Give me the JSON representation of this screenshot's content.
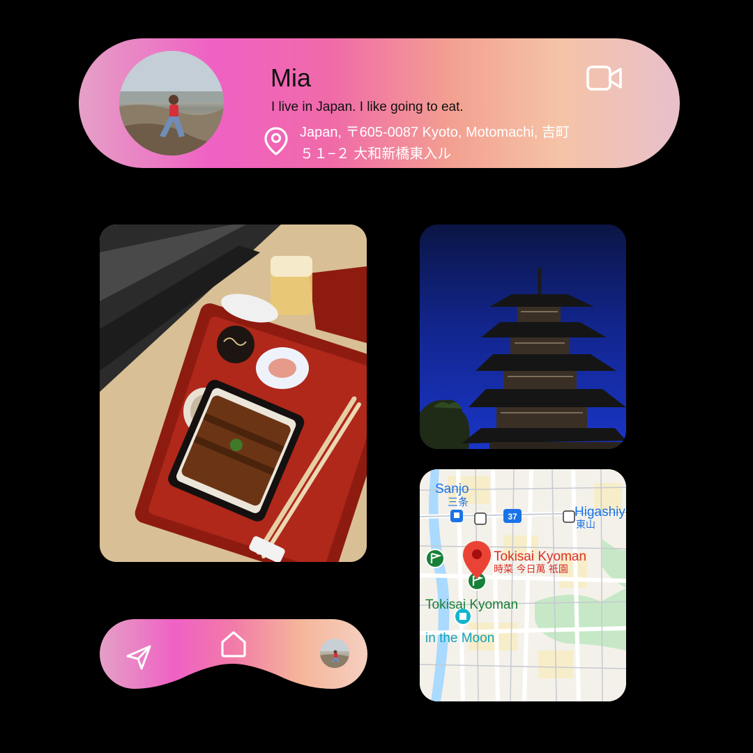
{
  "profile": {
    "name": "Mia",
    "bio": "I live in Japan. I like going to eat.",
    "address_line1": "Japan, 〒605-0087 Kyoto, Motomachi, 吉町",
    "address_line2": "５１−２ 大和新橋東入ル",
    "icons": {
      "location": "map-pin-icon",
      "video": "video-camera-icon"
    }
  },
  "map": {
    "labels": {
      "sanjo": "Sanjo",
      "sanjo_jp": "三条",
      "route": "37",
      "higashiyama": "Higashiy",
      "higashiyama_jp": "東山",
      "place_en": "Tokisai Kyoman",
      "place_jp": "時菜 今日萬 祇園",
      "place_en_2": "Tokisai Kyoman",
      "moon": "in the Moon"
    },
    "colors": {
      "pin": "#ea4335",
      "park": "#c6e8c6",
      "water": "#aadaff",
      "green_marker": "#188038",
      "teal_marker": "#12b5cb"
    }
  },
  "nav": {
    "icons": {
      "send": "send-icon",
      "home": "home-icon",
      "profile": "avatar"
    }
  },
  "colors": {
    "background": "#000000",
    "gradient": [
      "#e5a0c6",
      "#ef61c4",
      "#f06aa8",
      "#f3a091",
      "#f5c3a6",
      "#e8c0cc"
    ]
  }
}
